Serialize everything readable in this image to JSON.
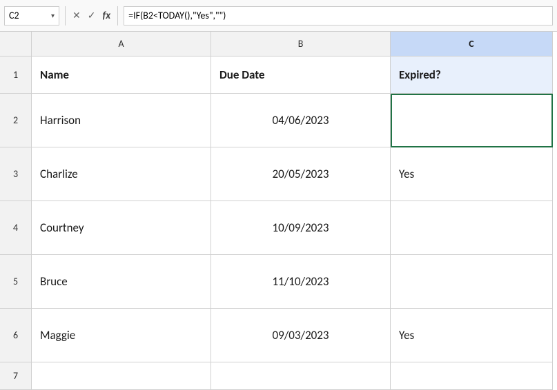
{
  "formulaBar": {
    "cellRef": "C2",
    "formula": "=IF(B2<TODAY(),\"Yes\",\"\")",
    "icons": {
      "close": "✕",
      "check": "✓",
      "fx": "fx"
    }
  },
  "columns": {
    "corner": "",
    "headers": [
      "A",
      "B",
      "C"
    ]
  },
  "rows": [
    {
      "rowNum": "1",
      "cells": [
        {
          "value": "Name",
          "bold": true,
          "align": "left"
        },
        {
          "value": "Due Date",
          "bold": true,
          "align": "left"
        },
        {
          "value": "Expired?",
          "bold": true,
          "align": "center"
        }
      ]
    },
    {
      "rowNum": "2",
      "cells": [
        {
          "value": "Harrison",
          "bold": false,
          "align": "left"
        },
        {
          "value": "04/06/2023",
          "bold": false,
          "align": "center"
        },
        {
          "value": "",
          "bold": false,
          "align": "left",
          "selected": true
        }
      ]
    },
    {
      "rowNum": "3",
      "cells": [
        {
          "value": "Charlize",
          "bold": false,
          "align": "left"
        },
        {
          "value": "20/05/2023",
          "bold": false,
          "align": "center"
        },
        {
          "value": "Yes",
          "bold": false,
          "align": "left"
        }
      ]
    },
    {
      "rowNum": "4",
      "cells": [
        {
          "value": "Courtney",
          "bold": false,
          "align": "left"
        },
        {
          "value": "10/09/2023",
          "bold": false,
          "align": "center"
        },
        {
          "value": "",
          "bold": false,
          "align": "left"
        }
      ]
    },
    {
      "rowNum": "5",
      "cells": [
        {
          "value": "Bruce",
          "bold": false,
          "align": "left"
        },
        {
          "value": "11/10/2023",
          "bold": false,
          "align": "center"
        },
        {
          "value": "",
          "bold": false,
          "align": "left"
        }
      ]
    },
    {
      "rowNum": "6",
      "cells": [
        {
          "value": "Maggie",
          "bold": false,
          "align": "left"
        },
        {
          "value": "09/03/2023",
          "bold": false,
          "align": "center"
        },
        {
          "value": "Yes",
          "bold": false,
          "align": "left"
        }
      ]
    }
  ],
  "lastRow": "7"
}
